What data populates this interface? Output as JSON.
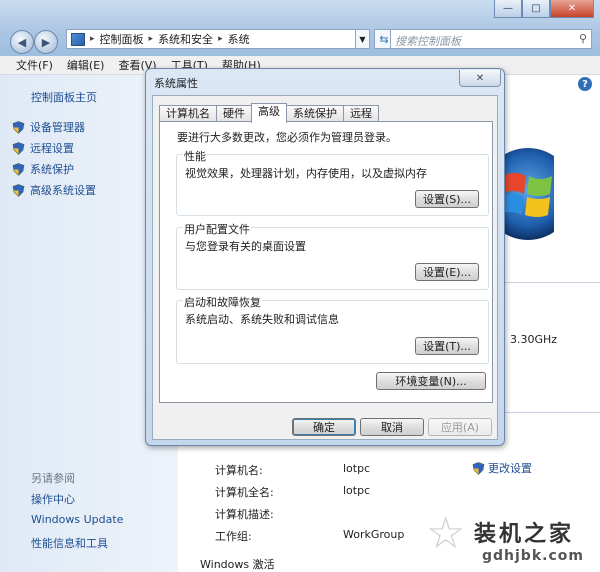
{
  "window": {
    "controls": [
      "—",
      "□",
      "✕"
    ],
    "breadcrumb": [
      "控制面板",
      "系统和安全",
      "系统"
    ],
    "search_placeholder": "搜索控制面板",
    "menu": [
      "文件(F)",
      "编辑(E)",
      "查看(V)",
      "工具(T)",
      "帮助(H)"
    ]
  },
  "left_pane": {
    "home": "控制面板主页",
    "items": [
      "设备管理器",
      "远程设置",
      "系统保护",
      "高级系统设置"
    ],
    "see_also_label": "另请参阅",
    "see_also": [
      "操作中心",
      "Windows Update",
      "性能信息和工具"
    ]
  },
  "content": {
    "cpu_speed": "3.30GHz",
    "rows": [
      {
        "label": "计算机名:",
        "value": "lotpc"
      },
      {
        "label": "计算机全名:",
        "value": "lotpc"
      },
      {
        "label": "计算机描述:",
        "value": ""
      },
      {
        "label": "工作组:",
        "value": "WorkGroup"
      }
    ],
    "change_settings": "更改设置",
    "activation": "Windows 激活"
  },
  "dialog": {
    "title": "系统属性",
    "close": "✕",
    "tabs": [
      "计算机名",
      "硬件",
      "高级",
      "系统保护",
      "远程"
    ],
    "active_tab": 2,
    "admin_note": "要进行大多数更改，您必须作为管理员登录。",
    "groups": [
      {
        "title": "性能",
        "desc": "视觉效果，处理器计划，内存使用，以及虚拟内存",
        "button": "设置(S)..."
      },
      {
        "title": "用户配置文件",
        "desc": "与您登录有关的桌面设置",
        "button": "设置(E)..."
      },
      {
        "title": "启动和故障恢复",
        "desc": "系统启动、系统失败和调试信息",
        "button": "设置(T)..."
      }
    ],
    "env_button": "环境变量(N)...",
    "ok": "确定",
    "cancel": "取消",
    "apply": "应用(A)"
  },
  "watermark": {
    "title": "装机之家",
    "url": "gdhjbk.com"
  },
  "colors": {
    "link": "#1d4f91",
    "titlebar": "#aac5e3",
    "dialog_frame": "#c4d7ee"
  }
}
